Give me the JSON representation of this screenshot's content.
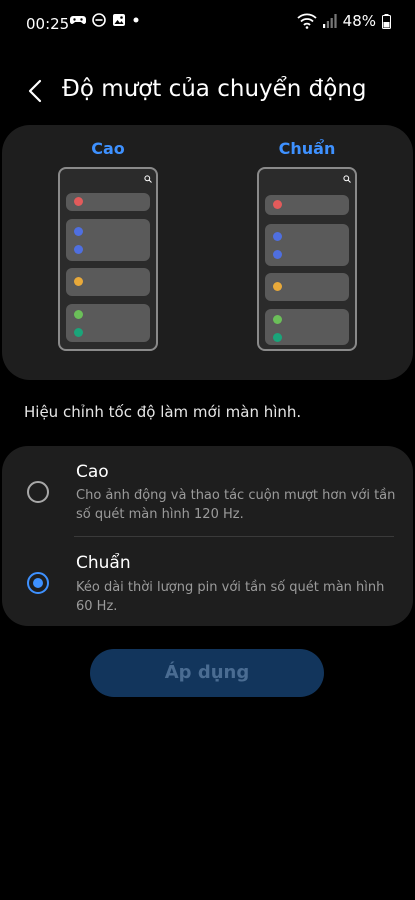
{
  "status_bar": {
    "time": "00:25",
    "battery_percent": "48%",
    "left_icons": [
      "game-controller-icon",
      "do-not-disturb-icon",
      "gallery-icon",
      "notification-dot-icon"
    ],
    "right_icons": [
      "wifi-icon",
      "signal-icon",
      "battery-icon"
    ]
  },
  "header": {
    "title": "Độ mượt của chuyển động",
    "back_icon": "chevron-left-icon"
  },
  "preview": {
    "left_label": "Cao",
    "right_label": "Chuẩn"
  },
  "description": "Hiệu chỉnh tốc độ làm mới màn hình.",
  "options": [
    {
      "title": "Cao",
      "subtitle": "Cho ảnh động và thao tác cuộn mượt hơn với tần số quét màn hình 120 Hz.",
      "selected": false
    },
    {
      "title": "Chuẩn",
      "subtitle": "Kéo dài thời lượng pin với tần số quét màn hình 60 Hz.",
      "selected": true
    }
  ],
  "apply_button": {
    "label": "Áp dụng",
    "enabled": false
  },
  "colors": {
    "accent": "#3e91ff",
    "background": "#000000",
    "card": "#1e1e1e",
    "apply_disabled_bg": "#12355c",
    "dot_red": "#e25b5b",
    "dot_blue": "#4f6fe0",
    "dot_yellow": "#e8a93a",
    "dot_green": "#6bbf59",
    "dot_teal": "#1aa57a"
  }
}
